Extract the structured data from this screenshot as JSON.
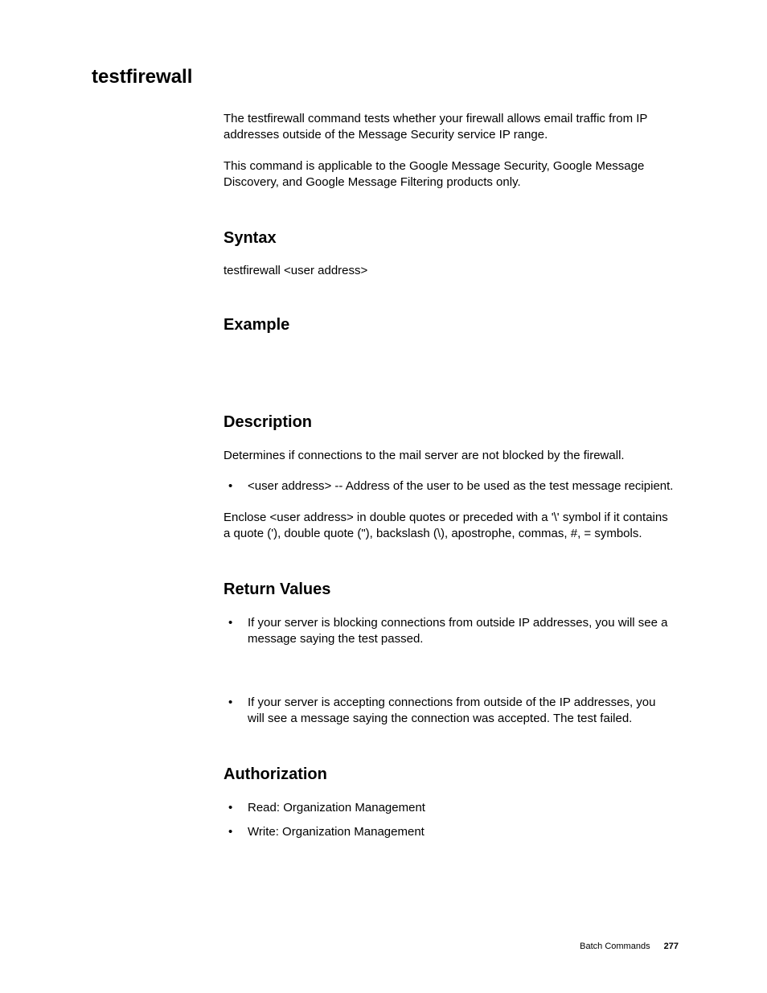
{
  "title": "testfirewall",
  "intro": {
    "p1": "The testfirewall command tests whether your firewall allows email traffic from IP addresses outside of the Message Security  service IP range.",
    "p2": "This command is applicable to the Google Message Security, Google Message Discovery, and Google Message Filtering products only."
  },
  "sections": {
    "syntax": {
      "heading": "Syntax",
      "line": "testfirewall <user address>"
    },
    "example": {
      "heading": "Example"
    },
    "description": {
      "heading": "Description",
      "p1": "Determines if connections to the mail server are not blocked by the firewall.",
      "bullets": [
        "<user address> -- Address of the user to be used as the test message recipient."
      ],
      "p2": "Enclose <user address> in double quotes or preceded with a '\\' symbol if it contains a quote ('), double quote (\"), backslash (\\), apostrophe, commas, #, = symbols."
    },
    "return_values": {
      "heading": "Return Values",
      "bullets": [
        "If your server is blocking connections from outside IP addresses, you will see a message saying the test passed.",
        "If your server is accepting connections from outside of the IP addresses, you will see a message saying the connection was accepted. The test failed."
      ]
    },
    "authorization": {
      "heading": "Authorization",
      "bullets": [
        "Read: Organization Management",
        "Write: Organization Management"
      ]
    }
  },
  "footer": {
    "label": "Batch Commands",
    "page": "277"
  }
}
